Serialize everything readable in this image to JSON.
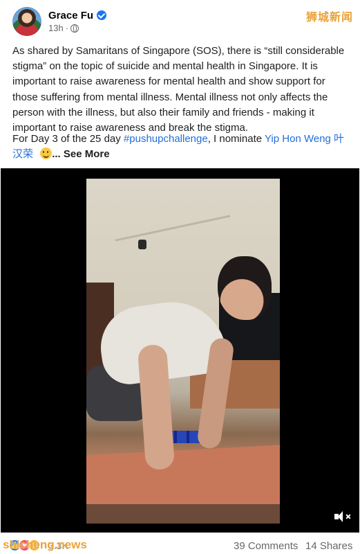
{
  "header": {
    "author_name": "Grace Fu",
    "timestamp": "13h",
    "watermark": "狮城新闻"
  },
  "post": {
    "paragraph1": "As shared by Samaritans of Singapore (SOS), there is “still considerable stigma” on the topic of suicide and mental health in Singapore. It is important to raise awareness for mental health and show support for those suffering from mental illness. Mental illness not only affects the person with the illness, but also their family and friends - making it important to raise awareness and break the stigma.",
    "p2_prefix": "For Day 3 of the 25 day ",
    "hashtag": "#pushupchallenge",
    "p2_middle": ", I nominate ",
    "mention": "Yip Hon Weng 叶汉荣",
    "see_more": "... See More"
  },
  "video": {
    "muted": true,
    "volume_icon": "volume-muted-icon"
  },
  "footer": {
    "reaction_count": "3.3K",
    "comments": "39 Comments",
    "shares": "14 Shares",
    "watermark": "shicheng.news"
  },
  "colors": {
    "link": "#216fdb",
    "verified": "#1877f2",
    "watermark": "#e8a33a"
  }
}
